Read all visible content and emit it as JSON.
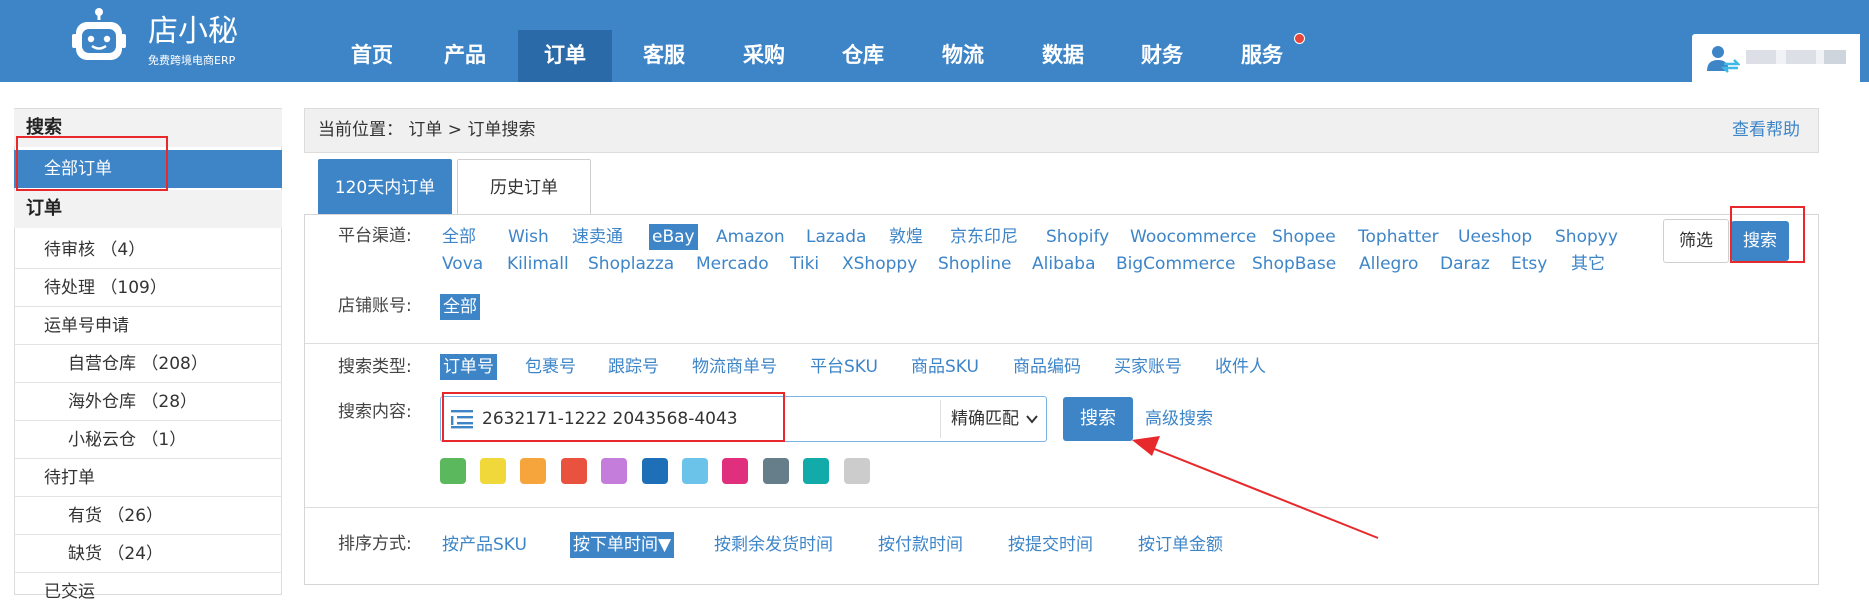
{
  "header": {
    "logo_text": "店小秘",
    "logo_sub": "免费跨境电商ERP",
    "nav": [
      {
        "label": "首页",
        "active": false
      },
      {
        "label": "产品",
        "active": false
      },
      {
        "label": "订单",
        "active": true
      },
      {
        "label": "客服",
        "active": false
      },
      {
        "label": "采购",
        "active": false
      },
      {
        "label": "仓库",
        "active": false
      },
      {
        "label": "物流",
        "active": false
      },
      {
        "label": "数据",
        "active": false
      },
      {
        "label": "财务",
        "active": false
      },
      {
        "label": "服务",
        "active": false,
        "badge_dot": true
      }
    ],
    "user_icon": "user-switch-icon"
  },
  "sidebar": {
    "search_title": "搜索",
    "all_orders": "全部订单",
    "order_title": "订单",
    "items": [
      {
        "label": "待审核 （4）",
        "level": 1
      },
      {
        "label": "待处理 （109）",
        "level": 1
      },
      {
        "label": "运单号申请",
        "level": 1
      },
      {
        "label": "自营仓库 （208）",
        "level": 2
      },
      {
        "label": "海外仓库 （28）",
        "level": 2
      },
      {
        "label": "小秘云仓 （1）",
        "level": 2
      },
      {
        "label": "待打单",
        "level": 1
      },
      {
        "label": "有货 （26）",
        "level": 2
      },
      {
        "label": "缺货 （24）",
        "level": 2
      },
      {
        "label": "已交运",
        "level": 1
      }
    ]
  },
  "breadcrumb": {
    "text": "当前位置：  订单 > 订单搜索",
    "help": "查看帮助"
  },
  "tabs": [
    {
      "label": "120天内订单",
      "active": true
    },
    {
      "label": "历史订单",
      "active": false
    }
  ],
  "filters": {
    "platform_label": "平台渠道:",
    "platforms_row1": [
      "全部",
      "Wish",
      "速卖通",
      "eBay",
      "Amazon",
      "Lazada",
      "敦煌",
      "京东印尼",
      "Shopify",
      "Woocommerce",
      "Shopee",
      "Tophatter",
      "Ueeshop",
      "Shopyy"
    ],
    "platforms_row2": [
      "Vova",
      "Kilimall",
      "Shoplazza",
      "Mercado",
      "Tiki",
      "XShoppy",
      "Shopline",
      "Alibaba",
      "BigCommerce",
      "ShopBase",
      "Allegro",
      "Daraz",
      "Etsy",
      "其它"
    ],
    "selected_platform": "eBay",
    "store_label": "店铺账号:",
    "store_value": "全部",
    "filter_button": "筛选",
    "search_button": "搜索"
  },
  "search": {
    "type_label": "搜索类型:",
    "types": [
      "订单号",
      "包裹号",
      "跟踪号",
      "物流商单号",
      "平台SKU",
      "商品SKU",
      "商品编码",
      "买家账号",
      "收件人"
    ],
    "selected_type": "订单号",
    "content_label": "搜索内容:",
    "input_value": "2632171-1222 2043568-4043",
    "match_mode": "精确匹配",
    "search_button": "搜索",
    "advanced": "高级搜索",
    "colors": [
      "#5cb85c",
      "#f0d83a",
      "#f6a53c",
      "#e8523f",
      "#c57ddc",
      "#1f6fb8",
      "#6cc3ea",
      "#e0307d",
      "#667d8a",
      "#13aaaa",
      "#cccccc"
    ]
  },
  "sort": {
    "label": "排序方式:",
    "options": [
      "按产品SKU",
      "按下单时间▼",
      "按剩余发货时间",
      "按付款时间",
      "按提交时间",
      "按订单金额"
    ],
    "selected": "按下单时间▼"
  },
  "annotation": {
    "color": "#e8292c"
  }
}
